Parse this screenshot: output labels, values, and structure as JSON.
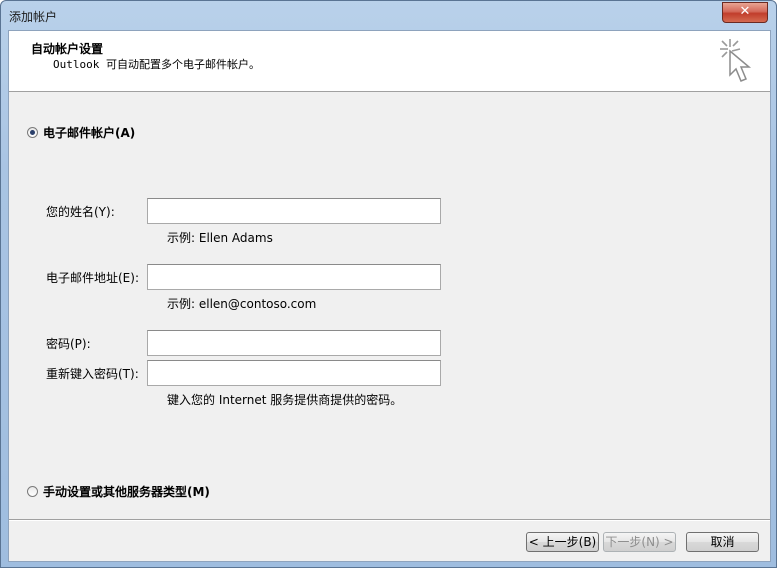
{
  "window": {
    "title": "添加帐户",
    "close_glyph": "✕"
  },
  "header": {
    "title": "自动帐户设置",
    "subtitle": "Outlook 可自动配置多个电子邮件帐户。"
  },
  "options": {
    "email_account_label": "电子邮件帐户(A)",
    "manual_label": "手动设置或其他服务器类型(M)"
  },
  "form": {
    "name_label": "您的姓名(Y):",
    "name_value": "",
    "name_hint": "示例: Ellen Adams",
    "email_label": "电子邮件地址(E):",
    "email_value": "",
    "email_hint": "示例: ellen@contoso.com",
    "password_label": "密码(P):",
    "password_value": "",
    "retype_label": "重新键入密码(T):",
    "retype_value": "",
    "password_hint": "键入您的 Internet 服务提供商提供的密码。"
  },
  "buttons": {
    "back": "< 上一步(B)",
    "next": "下一步(N) >",
    "cancel": "取消"
  },
  "icons": {
    "wizard": "cursor-sparkle-icon"
  }
}
